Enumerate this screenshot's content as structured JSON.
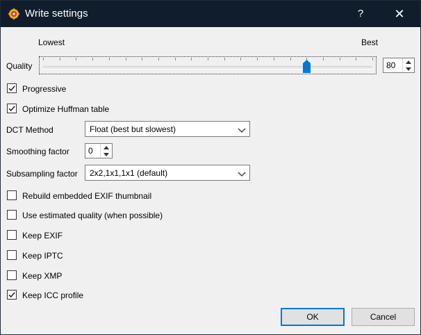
{
  "window": {
    "title": "Write settings",
    "help_glyph": "?",
    "close_glyph": "✕",
    "app_icon": "xnview-icon"
  },
  "quality": {
    "label": "Quality",
    "min_label": "Lowest",
    "max_label": "Best",
    "value": "80",
    "slider_level": 0.8
  },
  "checkboxes": {
    "progressive": {
      "label": "Progressive",
      "checked": true
    },
    "optimize_huffman": {
      "label": "Optimize Huffman table",
      "checked": true
    },
    "rebuild_exif_thumb": {
      "label": "Rebuild embedded EXIF thumbnail",
      "checked": false
    },
    "estimated_quality": {
      "label": "Use estimated quality (when possible)",
      "checked": false
    },
    "keep_exif": {
      "label": "Keep EXIF",
      "checked": false
    },
    "keep_iptc": {
      "label": "Keep IPTC",
      "checked": false
    },
    "keep_xmp": {
      "label": "Keep XMP",
      "checked": false
    },
    "keep_icc": {
      "label": "Keep ICC profile",
      "checked": true
    }
  },
  "dct": {
    "label": "DCT Method",
    "value": "Float (best but slowest)"
  },
  "smoothing": {
    "label": "Smoothing factor",
    "value": "0"
  },
  "subsampling": {
    "label": "Subsampling factor",
    "value": "2x2,1x1,1x1 (default)"
  },
  "buttons": {
    "ok": "OK",
    "cancel": "Cancel"
  },
  "colors": {
    "titlebar": "#0f1d2c",
    "accent": "#0078d7",
    "background": "#f0f0f0"
  }
}
